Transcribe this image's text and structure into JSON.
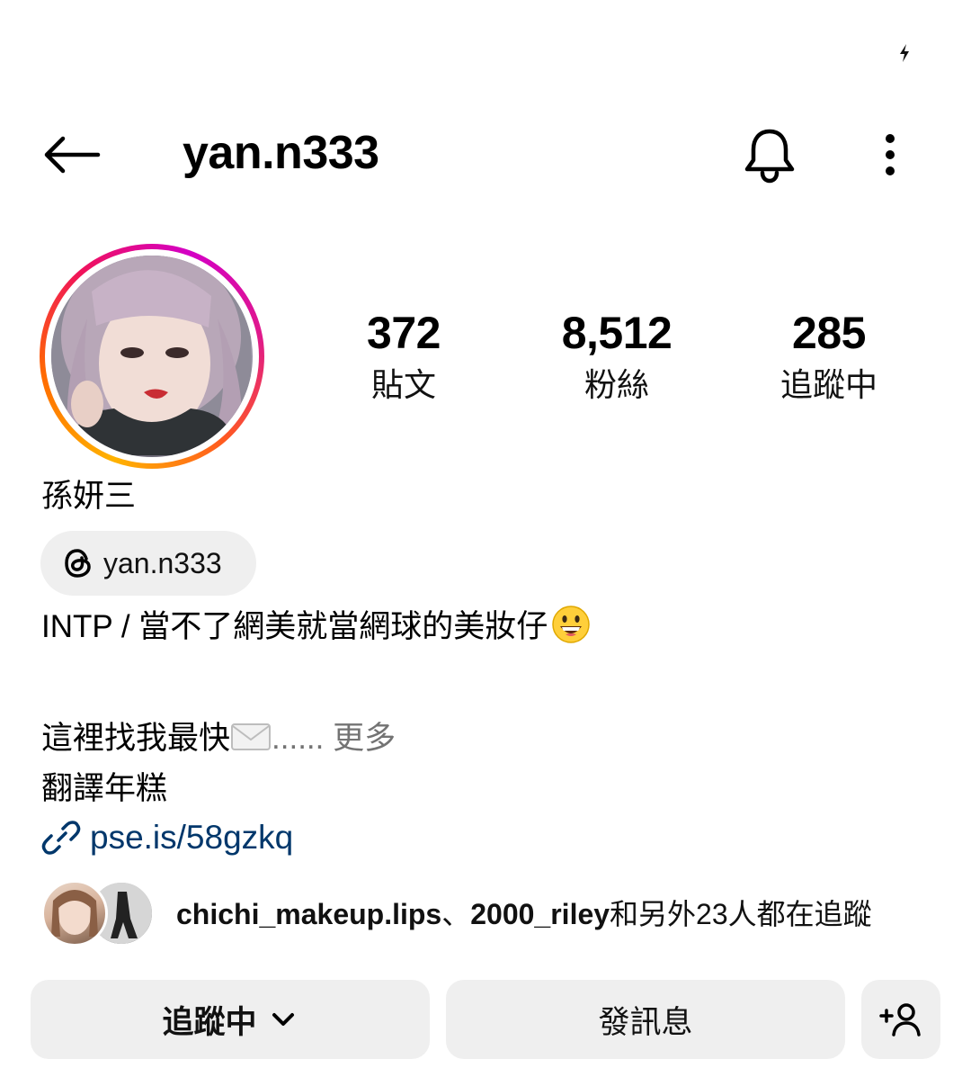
{
  "header": {
    "username": "yan.n333",
    "back_icon": "arrow-left-icon",
    "bell_icon": "bell-icon",
    "more_icon": "vertical-ellipsis-icon"
  },
  "status_bar": {
    "icon": "lightning-bolt-icon"
  },
  "stats": [
    {
      "value": "372",
      "label": "貼文"
    },
    {
      "value": "8,512",
      "label": "粉絲"
    },
    {
      "value": "285",
      "label": "追蹤中"
    }
  ],
  "profile": {
    "full_name": "孫妍三",
    "threads_handle": "yan.n333",
    "threads_icon": "threads-logo-icon",
    "bio_line1": "INTP / 當不了網美就當網球的美妝仔",
    "bio_line1_emoji": "grinning-face-emoji",
    "bio_line2": "這裡找我最快",
    "bio_line2_emoji": "envelope-emoji",
    "bio_line2_ellipsis": "......",
    "more_label": "更多",
    "bio_line3": "翻譯年糕",
    "link": "pse.is/58gzkq",
    "link_icon": "link-icon"
  },
  "followed_by": {
    "user1": "chichi_makeup.lips",
    "separator": "、",
    "user2": "2000_riley",
    "suffix": "和另外23人都在追蹤"
  },
  "actions": {
    "following_label": "追蹤中",
    "following_icon": "chevron-down-icon",
    "message_label": "發訊息",
    "add_user_icon": "add-person-icon"
  },
  "colors": {
    "link": "#00376b",
    "button_bg": "#efefef",
    "muted_text": "#737373"
  }
}
